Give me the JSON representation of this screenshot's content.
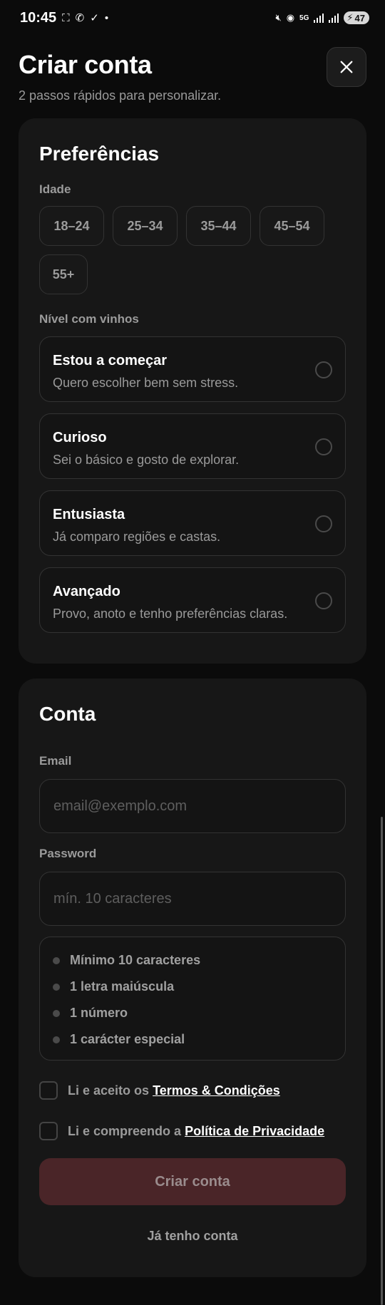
{
  "status_bar": {
    "time": "10:45",
    "battery": "47",
    "network": "5G"
  },
  "header": {
    "title": "Criar conta",
    "subtitle": "2 passos rápidos para personalizar."
  },
  "preferences": {
    "title": "Preferências",
    "age_label": "Idade",
    "age_options": [
      "18–24",
      "25–34",
      "35–44",
      "45–54",
      "55+"
    ],
    "level_label": "Nível com vinhos",
    "levels": [
      {
        "title": "Estou a começar",
        "subtitle": "Quero escolher bem sem stress."
      },
      {
        "title": "Curioso",
        "subtitle": "Sei o básico e gosto de explorar."
      },
      {
        "title": "Entusiasta",
        "subtitle": "Já comparo regiões e castas."
      },
      {
        "title": "Avançado",
        "subtitle": "Provo, anoto e tenho preferências claras."
      }
    ]
  },
  "account": {
    "title": "Conta",
    "email_label": "Email",
    "email_placeholder": "email@exemplo.com",
    "password_label": "Password",
    "password_placeholder": "mín. 10 caracteres",
    "password_rules": [
      "Mínimo 10 caracteres",
      "1 letra maiúscula",
      "1 número",
      "1 carácter especial"
    ],
    "terms_text": "Li e aceito os",
    "terms_link": "Termos & Condições",
    "privacy_text": "Li e compreendo a",
    "privacy_link": "Política de Privacidade",
    "submit_label": "Criar conta",
    "login_link": "Já tenho conta"
  },
  "colors": {
    "background": "#0b0b0b",
    "card": "#171717",
    "submit_disabled": "#4a2528"
  }
}
